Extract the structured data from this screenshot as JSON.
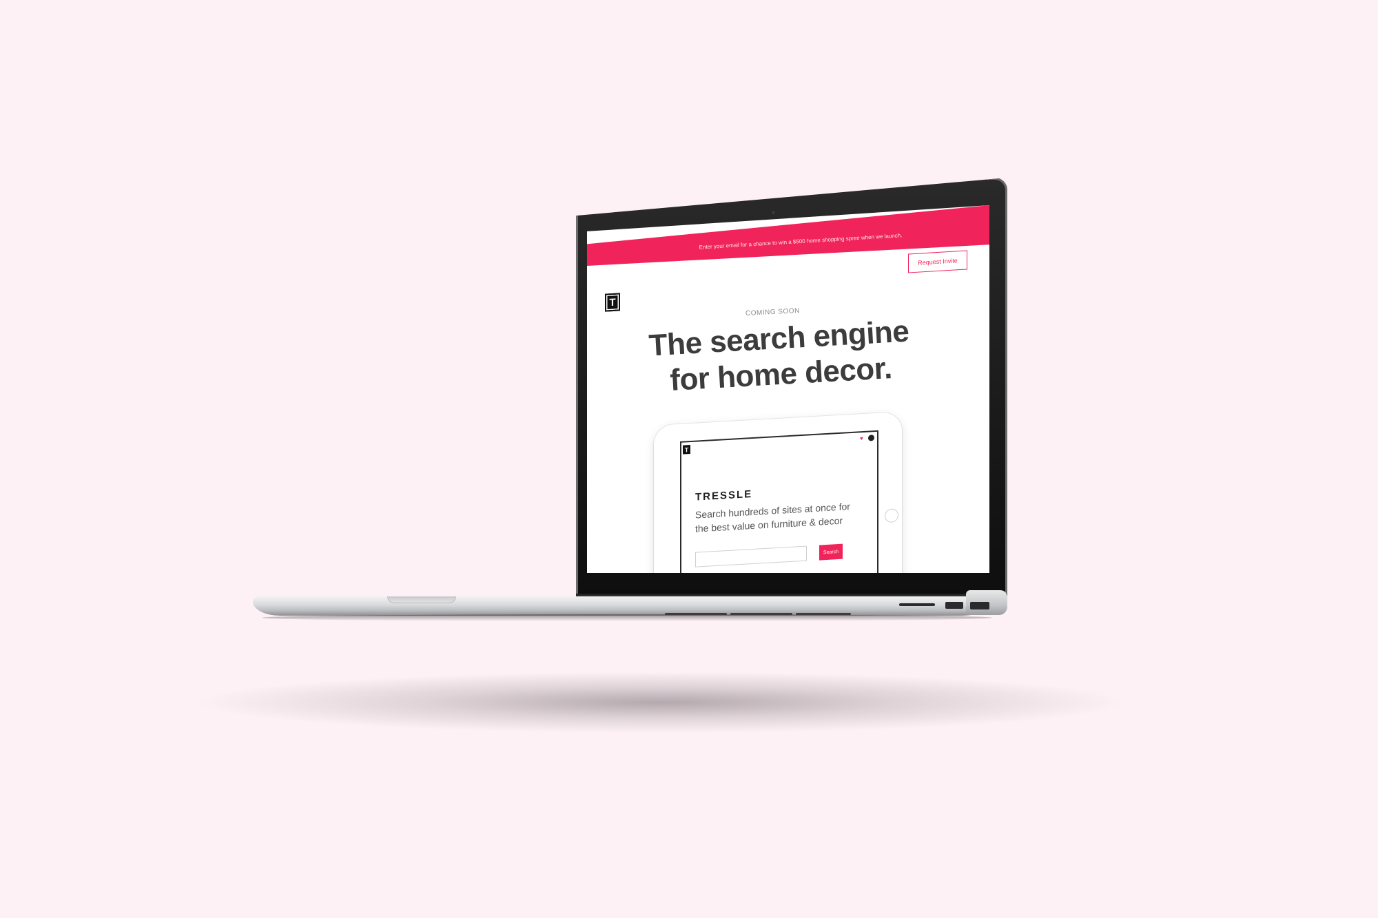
{
  "colors": {
    "background": "#fdf1f5",
    "accent": "#f0245a",
    "headline": "#3c3c3c"
  },
  "website": {
    "banner_text": "Enter your email for a chance to win a $500 home shopping spree when we launch.",
    "request_invite_label": "Request Invite",
    "logo_letter": "T",
    "coming_soon": "COMING SOON",
    "headline": "The search engine for home decor."
  },
  "tablet": {
    "logo_letter": "T",
    "brand": "TRESSLE",
    "tagline": "Search hundreds of sites at once for the best value on furniture & decor",
    "search_button_label": "Search",
    "icons": [
      "heart-icon",
      "user-icon"
    ]
  }
}
